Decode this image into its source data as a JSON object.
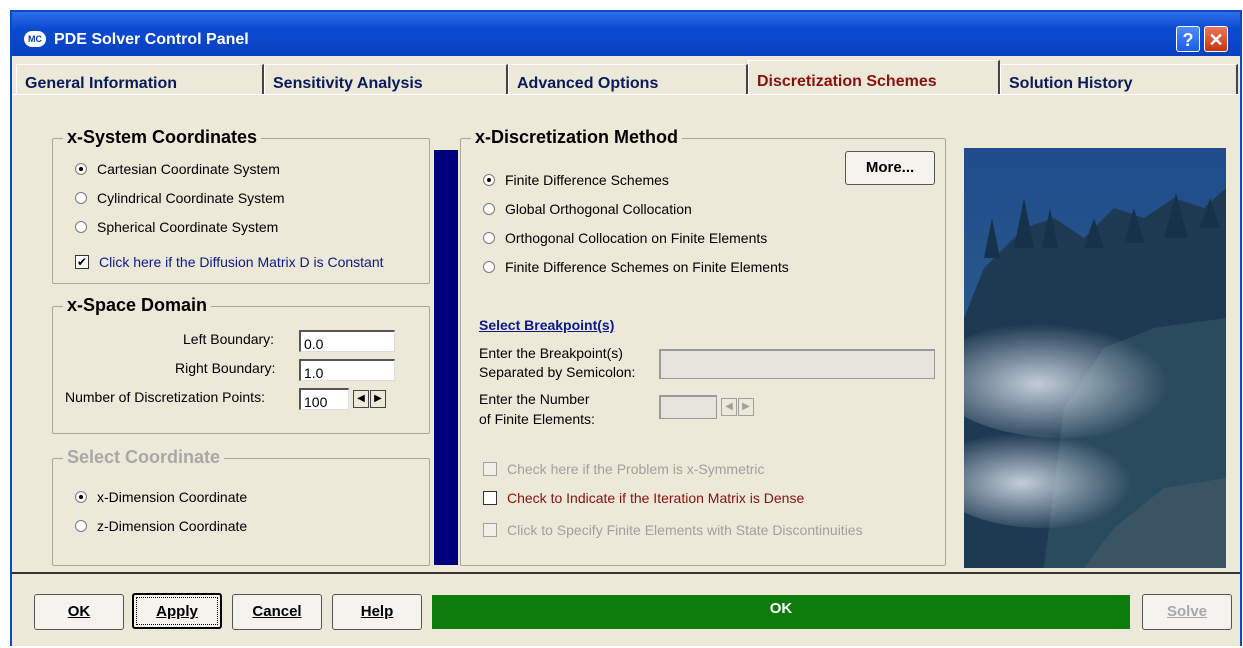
{
  "window": {
    "title": "PDE Solver Control Panel",
    "logo_text": "MC",
    "help_glyph": "?",
    "close_glyph": "✕"
  },
  "tabs": [
    {
      "label": "General Information"
    },
    {
      "label": "Sensitivity Analysis"
    },
    {
      "label": "Advanced Options"
    },
    {
      "label": "Discretization Schemes",
      "active": true
    },
    {
      "label": "Solution History"
    }
  ],
  "coords": {
    "title": "x-System Coordinates",
    "options": [
      "Cartesian Coordinate System",
      "Cylindrical Coordinate System",
      "Spherical Coordinate System"
    ],
    "selected": "Cartesian Coordinate System",
    "diffusion_check": "Click here if the Diffusion Matrix D is Constant",
    "diffusion_checked": true
  },
  "space": {
    "title": "x-Space Domain",
    "left_label": "Left Boundary:",
    "left_value": "0.0",
    "right_label": "Right Boundary:",
    "right_value": "1.0",
    "points_label": "Number of Discretization Points:",
    "points_value": "100"
  },
  "select_coord": {
    "title": "Select Coordinate",
    "options": [
      "x-Dimension Coordinate",
      "z-Dimension Coordinate"
    ],
    "selected": "x-Dimension Coordinate"
  },
  "method": {
    "title": "x-Discretization Method",
    "more_label": "More...",
    "options": [
      "Finite Difference Schemes",
      "Global Orthogonal Collocation",
      "Orthogonal Collocation on Finite Elements",
      "Finite Difference Schemes on Finite Elements"
    ],
    "selected": "Finite Difference Schemes",
    "breakpoint_link": "Select Breakpoint(s)",
    "breakpoint_label_1": "Enter the Breakpoint(s)",
    "breakpoint_label_2": "Separated by Semicolon:",
    "elements_label_1": "Enter the Number",
    "elements_label_2": "of Finite Elements:",
    "symmetric_check": "Check here if the Problem is x-Symmetric",
    "dense_check": "Check to Indicate if the  Iteration Matrix is Dense",
    "discontinuity_check": "Click to Specify Finite Elements with State Discontinuities"
  },
  "bottom": {
    "ok_label": "OK",
    "apply_label": "Apply",
    "cancel_label": "Cancel",
    "help_label": "Help",
    "status_text": "OK",
    "solve_label": "Solve"
  },
  "colors": {
    "title_blue": "#0a4ad0",
    "tab_active": "#8a1010",
    "divider": "#00007c",
    "status_green": "#0c7c0c"
  }
}
